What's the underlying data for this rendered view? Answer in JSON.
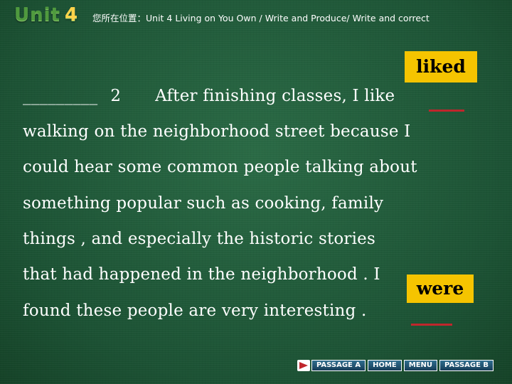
{
  "header": {
    "logo_word": "Unit",
    "logo_num": "4",
    "location": "您所在位置：Unit 4 Living on You Own / Write and Produce/ Write and correct"
  },
  "content": {
    "blank": "_________",
    "number": "2",
    "lines": [
      "After finishing classes, I like",
      "walking on the neighborhood street because I",
      "could  hear  some common people talking about",
      "something popular  such as cooking, family",
      "things ,  and  especially  the  historic stories",
      "that  had    happened    in  the  neighborhood .  I",
      "found  these  people  are  very  interesting ."
    ]
  },
  "corrections": [
    {
      "word": "liked"
    },
    {
      "word": "were"
    }
  ],
  "nav": {
    "passage_a": "PASSAGE A",
    "home": "HOME",
    "menu": "MENU",
    "passage_b": "PASSAGE B"
  },
  "colors": {
    "correction_box": "#f5c400",
    "underline": "#c0262c",
    "background": "#1f5a3a"
  }
}
